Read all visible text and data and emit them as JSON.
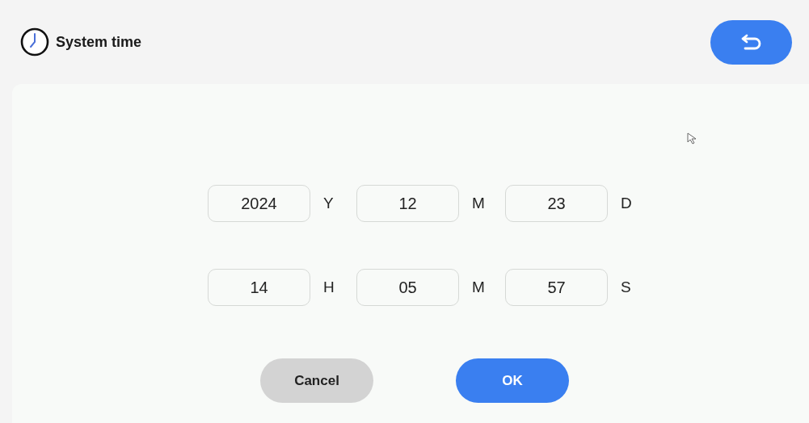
{
  "header": {
    "title": "System time"
  },
  "rows": [
    [
      {
        "value": "2024",
        "unit": "Y"
      },
      {
        "value": "12",
        "unit": "M"
      },
      {
        "value": "23",
        "unit": "D"
      }
    ],
    [
      {
        "value": "14",
        "unit": "H"
      },
      {
        "value": "05",
        "unit": "M"
      },
      {
        "value": "57",
        "unit": "S"
      }
    ]
  ],
  "buttons": [
    {
      "label": "Cancel",
      "kind": "secondary"
    },
    {
      "label": "OK",
      "kind": "primary"
    }
  ]
}
